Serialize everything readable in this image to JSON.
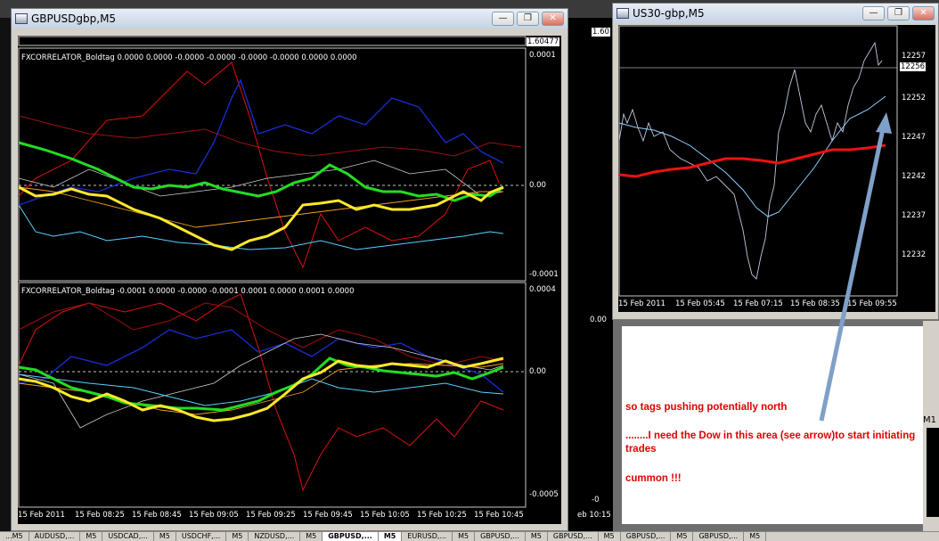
{
  "gbp_window": {
    "title": "GBPUSDgbp,M5",
    "price_label": "1.60477",
    "pane1": {
      "label": "FXCORRELATOR_Boldtag 0.0000 0.0000 -0.0000 -0.0000 -0.0000 -0.0000 0.0000 0.0000",
      "y_ticks": [
        "0.0001",
        "0.00",
        "-0.0001"
      ]
    },
    "pane2": {
      "label": "FXCORRELATOR_Boldtag -0.0001 0.0000 -0.0000 -0.0001 0.0001 0.0000 0.0001 0.0000",
      "y_ticks": [
        "0.0004",
        "0.00",
        "-0.0005"
      ]
    },
    "x_ticks": [
      "15 Feb 2011",
      "15 Feb 08:25",
      "15 Feb 08:45",
      "15 Feb 09:05",
      "15 Feb 09:25",
      "15 Feb 09:45",
      "15 Feb 10:05",
      "15 Feb 10:25",
      "15 Feb 10:45"
    ]
  },
  "us30_window": {
    "title": "US30-gbp,M5",
    "price_label": "12256",
    "y_ticks": [
      "12257",
      "12252",
      "12247",
      "12242",
      "12237",
      "12232"
    ],
    "x_ticks": [
      "15 Feb 2011",
      "15 Feb 05:45",
      "15 Feb 07:15",
      "15 Feb 08:35",
      "15 Feb 09:55"
    ]
  },
  "background_fragments": {
    "price_160": "1.60",
    "mid_zero": "0.00",
    "mid_minus": "-0",
    "bottom_time": "eb 10:15",
    "m1_tag": "M1"
  },
  "annotation": {
    "line1": "so tags pushing potentially north",
    "line2": "........I need the Dow in this area (see arrow)to start initiating trades",
    "line3": "cummon !!!"
  },
  "bottom_tabs": [
    "...M5",
    "AUDUSD,...",
    "M5",
    "USDCAD,...",
    "M5",
    "USDCHF,...",
    "M5",
    "NZDUSD,...",
    "M5",
    "GBPUSD,...",
    "M5",
    "EURUSD,...",
    "M5",
    "GBPUSD,...",
    "M5",
    "GBPUSD,...",
    "M5",
    "GBPUSD,...",
    "M5",
    "GBPUSD,...",
    "M5"
  ],
  "colors": {
    "chart_bg": "#000000",
    "yellow_line": "#ffe92a",
    "green_line": "#22dd22",
    "blue_line": "#1a2dd6",
    "red_line": "#e01010",
    "dow_ma": "#ee1111",
    "annotation_text": "#e00000",
    "arrow": "#7fa0c8"
  }
}
